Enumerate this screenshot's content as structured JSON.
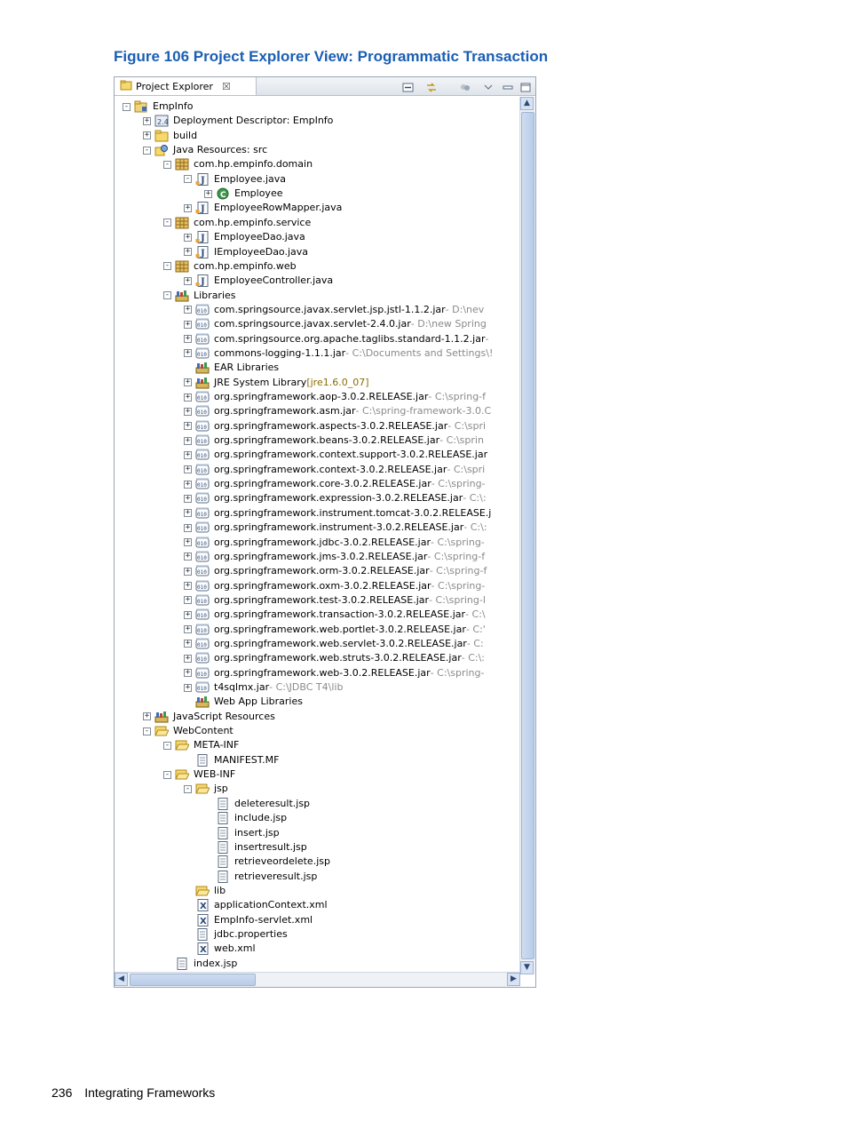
{
  "caption": "Figure 106 Project Explorer View: Programmatic Transaction",
  "view": {
    "tab_label": "Project Explorer",
    "close_glyph": "☒"
  },
  "tree": [
    {
      "label": "EmpInfo",
      "depth": 0,
      "exp": "-",
      "icon": "project-icon"
    },
    {
      "label": "Deployment Descriptor: EmpInfo",
      "depth": 1,
      "exp": "+",
      "icon": "descriptor-icon"
    },
    {
      "label": "build",
      "depth": 1,
      "exp": "+",
      "icon": "folder-icon"
    },
    {
      "label": "Java Resources: src",
      "depth": 1,
      "exp": "-",
      "icon": "java-resources-icon"
    },
    {
      "label": "com.hp.empinfo.domain",
      "depth": 2,
      "exp": "-",
      "icon": "package-icon"
    },
    {
      "label": "Employee.java",
      "depth": 3,
      "exp": "-",
      "icon": "java-file-icon"
    },
    {
      "label": "Employee",
      "depth": 4,
      "exp": "+",
      "icon": "class-icon"
    },
    {
      "label": "EmployeeRowMapper.java",
      "depth": 3,
      "exp": "+",
      "icon": "java-file-icon"
    },
    {
      "label": "com.hp.empinfo.service",
      "depth": 2,
      "exp": "-",
      "icon": "package-icon"
    },
    {
      "label": "EmployeeDao.java",
      "depth": 3,
      "exp": "+",
      "icon": "java-file-icon"
    },
    {
      "label": "IEmployeeDao.java",
      "depth": 3,
      "exp": "+",
      "icon": "java-file-icon"
    },
    {
      "label": "com.hp.empinfo.web",
      "depth": 2,
      "exp": "-",
      "icon": "package-icon"
    },
    {
      "label": "EmployeeController.java",
      "depth": 3,
      "exp": "+",
      "icon": "java-file-icon"
    },
    {
      "label": "Libraries",
      "depth": 2,
      "exp": "-",
      "icon": "library-icon"
    },
    {
      "label": "com.springsource.javax.servlet.jsp.jstl-1.1.2.jar",
      "suffix": " - D:\\nev",
      "depth": 3,
      "exp": "+",
      "icon": "jar-icon"
    },
    {
      "label": "com.springsource.javax.servlet-2.4.0.jar",
      "suffix": " - D:\\new Spring",
      "depth": 3,
      "exp": "+",
      "icon": "jar-icon"
    },
    {
      "label": "com.springsource.org.apache.taglibs.standard-1.1.2.jar",
      "suffix": " -",
      "depth": 3,
      "exp": "+",
      "icon": "jar-icon"
    },
    {
      "label": "commons-logging-1.1.1.jar",
      "suffix": " - C:\\Documents and Settings\\!",
      "depth": 3,
      "exp": "+",
      "icon": "jar-icon"
    },
    {
      "label": "EAR Libraries",
      "depth": 3,
      "exp": "",
      "icon": "library-icon"
    },
    {
      "label": "JRE System Library",
      "suffix_dec": " [jre1.6.0_07]",
      "depth": 3,
      "exp": "+",
      "icon": "library-icon"
    },
    {
      "label": "org.springframework.aop-3.0.2.RELEASE.jar",
      "suffix": " - C:\\spring-f",
      "depth": 3,
      "exp": "+",
      "icon": "jar-icon"
    },
    {
      "label": "org.springframework.asm.jar",
      "suffix": " - C:\\spring-framework-3.0.C",
      "depth": 3,
      "exp": "+",
      "icon": "jar-icon"
    },
    {
      "label": "org.springframework.aspects-3.0.2.RELEASE.jar",
      "suffix": " - C:\\spri",
      "depth": 3,
      "exp": "+",
      "icon": "jar-icon"
    },
    {
      "label": "org.springframework.beans-3.0.2.RELEASE.jar",
      "suffix": " - C:\\sprin",
      "depth": 3,
      "exp": "+",
      "icon": "jar-icon"
    },
    {
      "label": "org.springframework.context.support-3.0.2.RELEASE.jar",
      "suffix": "",
      "depth": 3,
      "exp": "+",
      "icon": "jar-icon"
    },
    {
      "label": "org.springframework.context-3.0.2.RELEASE.jar",
      "suffix": " - C:\\spri",
      "depth": 3,
      "exp": "+",
      "icon": "jar-icon"
    },
    {
      "label": "org.springframework.core-3.0.2.RELEASE.jar",
      "suffix": " - C:\\spring-",
      "depth": 3,
      "exp": "+",
      "icon": "jar-icon"
    },
    {
      "label": "org.springframework.expression-3.0.2.RELEASE.jar",
      "suffix": " - C:\\:",
      "depth": 3,
      "exp": "+",
      "icon": "jar-icon"
    },
    {
      "label": "org.springframework.instrument.tomcat-3.0.2.RELEASE.j",
      "suffix": "",
      "depth": 3,
      "exp": "+",
      "icon": "jar-icon"
    },
    {
      "label": "org.springframework.instrument-3.0.2.RELEASE.jar",
      "suffix": " - C:\\:",
      "depth": 3,
      "exp": "+",
      "icon": "jar-icon"
    },
    {
      "label": "org.springframework.jdbc-3.0.2.RELEASE.jar",
      "suffix": " - C:\\spring-",
      "depth": 3,
      "exp": "+",
      "icon": "jar-icon"
    },
    {
      "label": "org.springframework.jms-3.0.2.RELEASE.jar",
      "suffix": " - C:\\spring-f",
      "depth": 3,
      "exp": "+",
      "icon": "jar-icon"
    },
    {
      "label": "org.springframework.orm-3.0.2.RELEASE.jar",
      "suffix": " - C:\\spring-f",
      "depth": 3,
      "exp": "+",
      "icon": "jar-icon"
    },
    {
      "label": "org.springframework.oxm-3.0.2.RELEASE.jar",
      "suffix": " - C:\\spring-",
      "depth": 3,
      "exp": "+",
      "icon": "jar-icon"
    },
    {
      "label": "org.springframework.test-3.0.2.RELEASE.jar",
      "suffix": " - C:\\spring-l",
      "depth": 3,
      "exp": "+",
      "icon": "jar-icon"
    },
    {
      "label": "org.springframework.transaction-3.0.2.RELEASE.jar",
      "suffix": " - C:\\",
      "depth": 3,
      "exp": "+",
      "icon": "jar-icon"
    },
    {
      "label": "org.springframework.web.portlet-3.0.2.RELEASE.jar",
      "suffix": " - C:'",
      "depth": 3,
      "exp": "+",
      "icon": "jar-icon"
    },
    {
      "label": "org.springframework.web.servlet-3.0.2.RELEASE.jar",
      "suffix": " - C:",
      "depth": 3,
      "exp": "+",
      "icon": "jar-icon"
    },
    {
      "label": "org.springframework.web.struts-3.0.2.RELEASE.jar",
      "suffix": " - C:\\:",
      "depth": 3,
      "exp": "+",
      "icon": "jar-icon"
    },
    {
      "label": "org.springframework.web-3.0.2.RELEASE.jar",
      "suffix": " - C:\\spring-",
      "depth": 3,
      "exp": "+",
      "icon": "jar-icon"
    },
    {
      "label": "t4sqlmx.jar",
      "suffix": " - C:\\JDBC T4\\lib",
      "depth": 3,
      "exp": "+",
      "icon": "jar-icon"
    },
    {
      "label": "Web App Libraries",
      "depth": 3,
      "exp": "",
      "icon": "library-icon"
    },
    {
      "label": "JavaScript Resources",
      "depth": 1,
      "exp": "+",
      "icon": "library-icon"
    },
    {
      "label": "WebContent",
      "depth": 1,
      "exp": "-",
      "icon": "open-folder-icon"
    },
    {
      "label": "META-INF",
      "depth": 2,
      "exp": "-",
      "icon": "open-folder-icon"
    },
    {
      "label": "MANIFEST.MF",
      "depth": 3,
      "exp": "",
      "icon": "text-file-icon"
    },
    {
      "label": "WEB-INF",
      "depth": 2,
      "exp": "-",
      "icon": "open-folder-icon"
    },
    {
      "label": "jsp",
      "depth": 3,
      "exp": "-",
      "icon": "open-folder-icon"
    },
    {
      "label": "deleteresult.jsp",
      "depth": 4,
      "exp": "",
      "icon": "text-file-icon"
    },
    {
      "label": "include.jsp",
      "depth": 4,
      "exp": "",
      "icon": "text-file-icon"
    },
    {
      "label": "insert.jsp",
      "depth": 4,
      "exp": "",
      "icon": "text-file-icon"
    },
    {
      "label": "insertresult.jsp",
      "depth": 4,
      "exp": "",
      "icon": "text-file-icon"
    },
    {
      "label": "retrieveordelete.jsp",
      "depth": 4,
      "exp": "",
      "icon": "text-file-icon"
    },
    {
      "label": "retrieveresult.jsp",
      "depth": 4,
      "exp": "",
      "icon": "text-file-icon"
    },
    {
      "label": "lib",
      "depth": 3,
      "exp": "",
      "icon": "open-folder-icon"
    },
    {
      "label": "applicationContext.xml",
      "depth": 3,
      "exp": "",
      "icon": "xml-file-icon"
    },
    {
      "label": "EmpInfo-servlet.xml",
      "depth": 3,
      "exp": "",
      "icon": "xml-file-icon"
    },
    {
      "label": "jdbc.properties",
      "depth": 3,
      "exp": "",
      "icon": "text-file-icon"
    },
    {
      "label": "web.xml",
      "depth": 3,
      "exp": "",
      "icon": "xml-file-icon"
    },
    {
      "label": "index.jsp",
      "depth": 2,
      "exp": "",
      "icon": "text-file-icon"
    }
  ],
  "footer": {
    "page_number": "236",
    "section": "Integrating Frameworks"
  },
  "colors": {
    "caption": "#1a5fb4",
    "suffix": "#8a8a8a",
    "decoration": "#8a6d00"
  }
}
